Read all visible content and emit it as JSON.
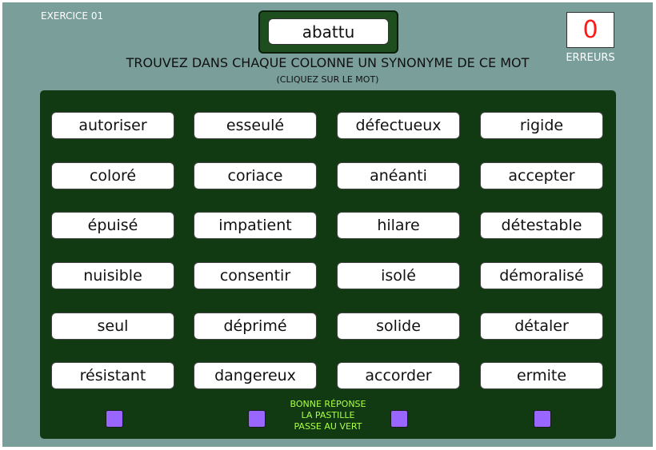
{
  "exercise_label": "EXERCICE 01",
  "target_word": "abattu",
  "errors": {
    "count": "0",
    "label": "ERREURS",
    "count_color": "#ff1a1a"
  },
  "instruction": "TROUVEZ DANS CHAQUE COLONNE UN SYNONYME DE CE MOT",
  "sub_instruction": "(CLIQUEZ SUR LE MOT)",
  "columns": [
    {
      "words": [
        "autoriser",
        "coloré",
        "épuisé",
        "nuisible",
        "seul",
        "résistant"
      ],
      "pastille_color": "#9966ff"
    },
    {
      "words": [
        "esseulé",
        "coriace",
        "impatient",
        "consentir",
        "déprimé",
        "dangereux"
      ],
      "pastille_color": "#9966ff"
    },
    {
      "words": [
        "défectueux",
        "anéanti",
        "hilare",
        "isolé",
        "solide",
        "accorder"
      ],
      "pastille_color": "#9966ff"
    },
    {
      "words": [
        "rigide",
        "accepter",
        "détestable",
        "démoralisé",
        "détaler",
        "ermite"
      ],
      "pastille_color": "#9966ff"
    }
  ],
  "hint": {
    "line1": "BONNE RÉPONSE",
    "line2": "LA PASTILLE",
    "line3": "PASSE AU VERT"
  },
  "colors": {
    "background": "#7a9e9a",
    "board": "#123a12",
    "hint_text": "#aaff44"
  }
}
